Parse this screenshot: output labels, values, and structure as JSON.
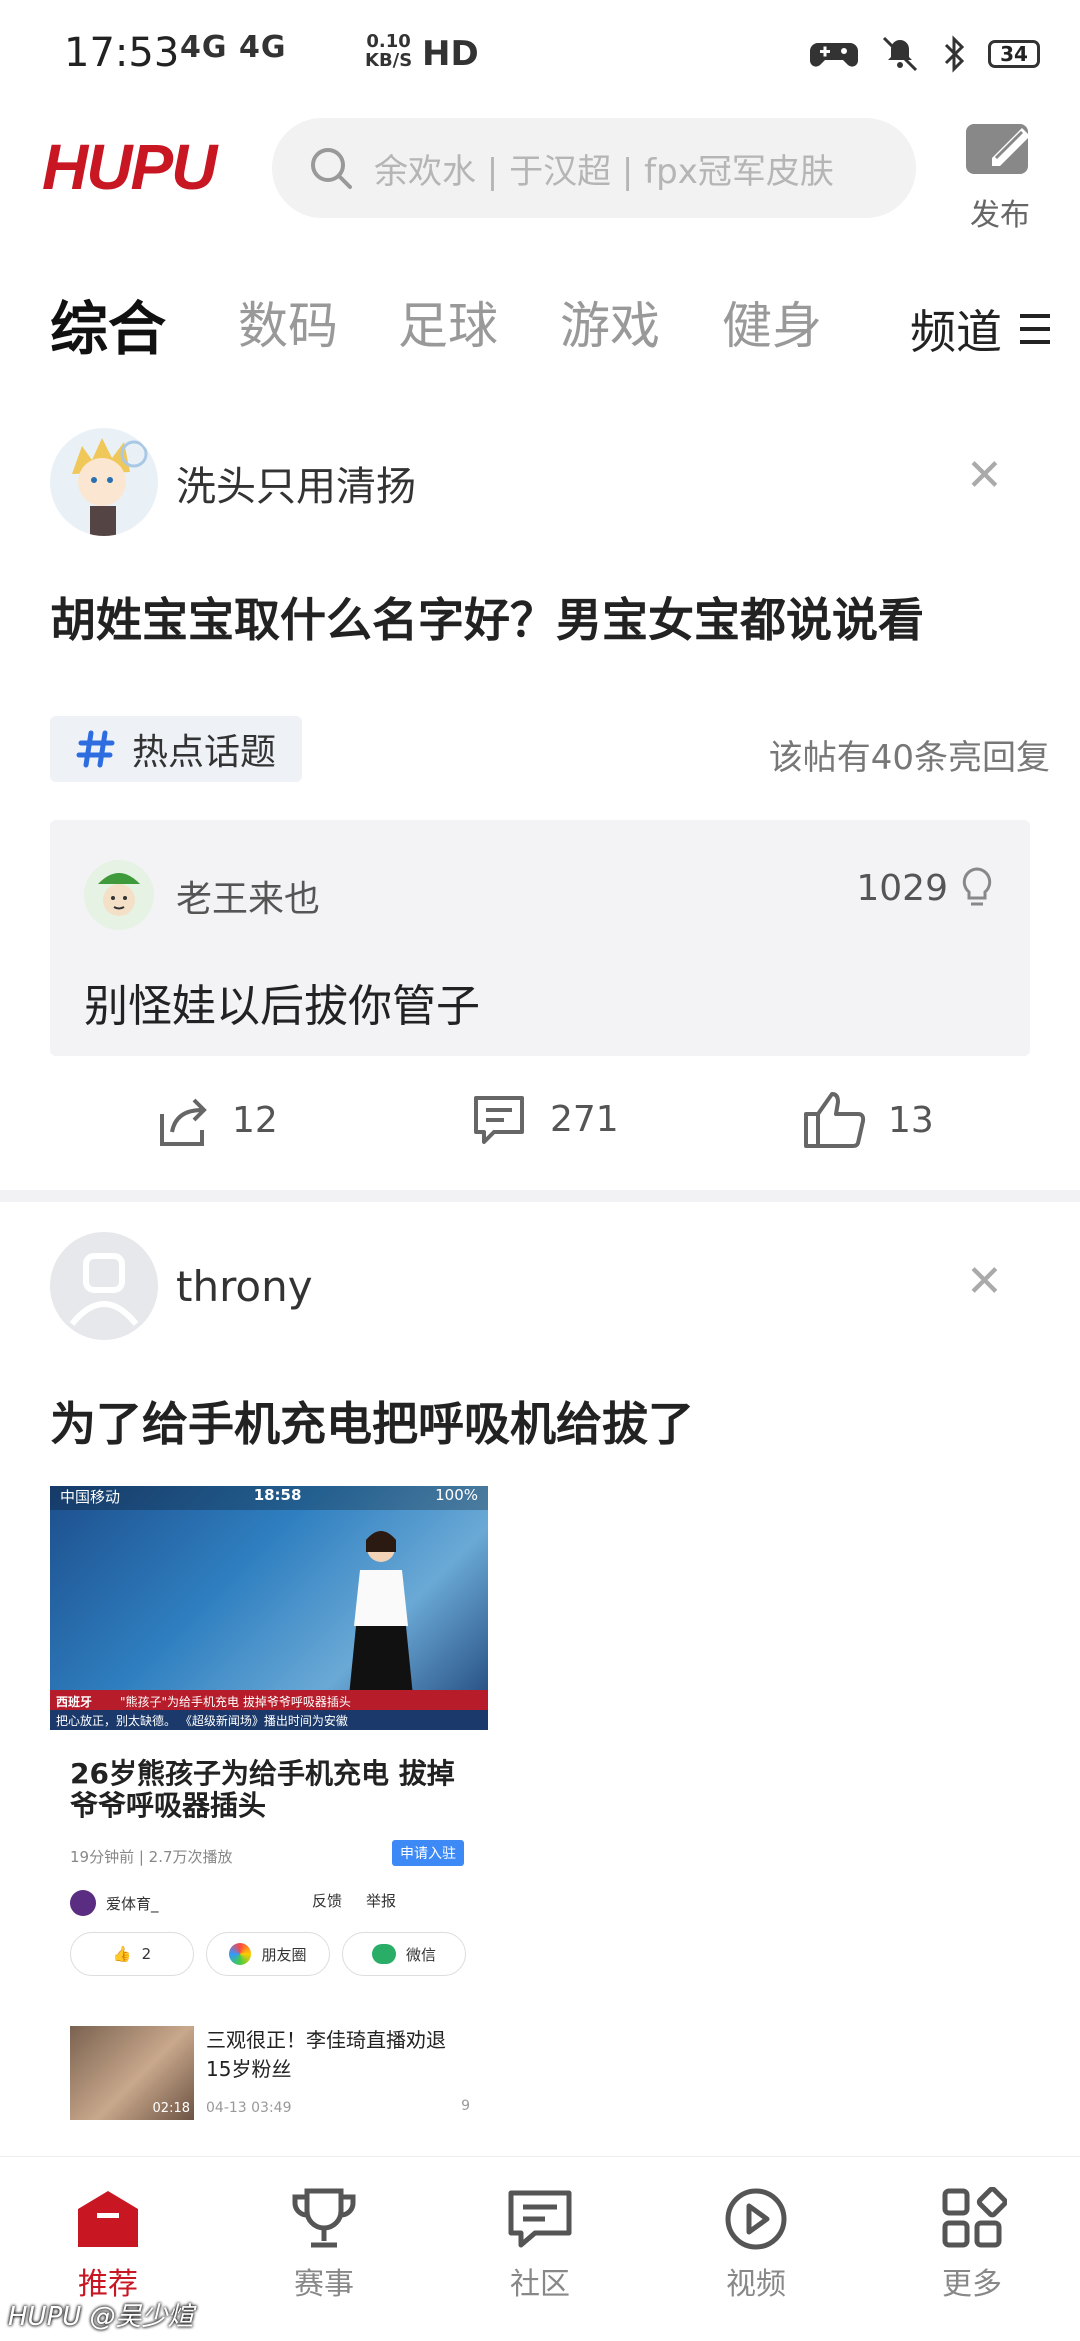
{
  "status_bar": {
    "time": "17:53",
    "network": "4G 4G",
    "speed_value": "0.10",
    "speed_unit": "KB/S",
    "hd": "HD",
    "battery": "34"
  },
  "header": {
    "logo": "HUPU",
    "search_placeholder": "余欢水 | 于汉超 | fpx冠军皮肤",
    "publish_label": "发布"
  },
  "tabs": [
    {
      "label": "综合",
      "active": true
    },
    {
      "label": "数码"
    },
    {
      "label": "足球"
    },
    {
      "label": "游戏"
    },
    {
      "label": "健身"
    }
  ],
  "channel_label": "频道",
  "posts": [
    {
      "author": "洗头只用清扬",
      "title": "胡姓宝宝取什么名字好？男宝女宝都说说看",
      "topic_tag": "热点话题",
      "reply_count_text": "该帖有40条亮回复",
      "top_reply": {
        "author": "老王来也",
        "likes": "1029",
        "text": "别怪娃以后拔你管子"
      },
      "actions": {
        "share": "12",
        "comment": "271",
        "like": "13"
      }
    },
    {
      "author": "throny",
      "title": "为了给手机充电把呼吸机给拔了",
      "embedded": {
        "status_carrier": "中国移动",
        "status_time": "18:58",
        "status_battery": "100%",
        "ticker_tag": "西班牙",
        "ticker_headline": "\"熊孩子\"为给手机充电 拔掉爷爷呼吸器插头",
        "ticker_sub": "把心放正，别太缺德。 《超级新闻场》播出时间为安徽",
        "video_title": "26岁熊孩子为给手机充电 拔掉爷爷呼吸器插头",
        "meta": "19分钟前 | 2.7万次播放",
        "apply_label": "申请入驻",
        "author": "爱体育_",
        "feedback": "反馈",
        "report": "举报",
        "like_count": "2",
        "moments": "朋友圈",
        "wechat": "微信",
        "related_title": "三观很正！李佳琦直播劝退15岁粉丝",
        "related_duration": "02:18",
        "related_date": "04-13 03:49",
        "related_comments": "9"
      }
    }
  ],
  "bottom_nav": [
    {
      "label": "推荐",
      "icon": "home-icon",
      "active": true
    },
    {
      "label": "赛事",
      "icon": "trophy-icon"
    },
    {
      "label": "社区",
      "icon": "chat-icon"
    },
    {
      "label": "视频",
      "icon": "play-icon"
    },
    {
      "label": "更多",
      "icon": "grid-icon"
    }
  ],
  "watermark": "HUPU @吴少煊",
  "colors": {
    "brand": "#c81623",
    "text_primary": "#222222",
    "text_muted": "#999999"
  }
}
